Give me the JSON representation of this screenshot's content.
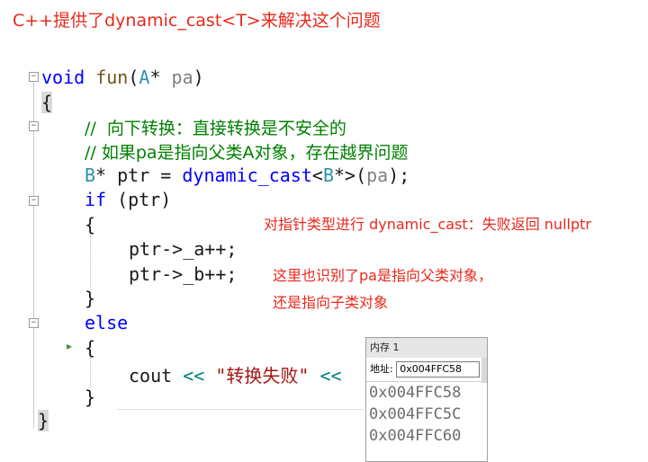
{
  "title": "C++提供了dynamic_cast<T>来解决这个问题",
  "code": {
    "line1": {
      "kw": "void",
      "fn": "fun",
      "open": "(",
      "type": "A",
      "star": "* ",
      "param": "pa",
      "close": ")"
    },
    "line2": "{",
    "line3": "//  向下转换：直接转换是不安全的",
    "line4": "// 如果pa是指向父类A对象，存在越界问题",
    "line5": {
      "type": "B",
      "star": "* ",
      "var": "ptr",
      "eq": " = ",
      "kw": "dynamic_cast",
      "lt": "<",
      "type2": "B",
      "star2": "*",
      "gt": ">",
      "open": "(",
      "param": "pa",
      "close": ");"
    },
    "line6": {
      "kw": "if",
      "rest": " (ptr)"
    },
    "line7": "{",
    "line8": "ptr->_a++;",
    "line9": "ptr->_b++;",
    "line10": "}",
    "line11": "else",
    "line12": "{",
    "line13": {
      "id": "cout",
      "op": " << ",
      "str": "\"转换失败\"",
      "op2": " <<"
    },
    "line14": "}",
    "line15": "}"
  },
  "annotations": {
    "a1": "对指针类型进行 dynamic_cast：失败返回 nullptr",
    "a2": "这里也识别了pa是指向父类对象，",
    "a3": "还是指向子类对象"
  },
  "memory": {
    "title": "内存 1",
    "addr_label": "地址:",
    "addr_value": "0x004FFC58",
    "rows": [
      "0x004FFC58",
      "0x004FFC5C",
      "0x004FFC60"
    ]
  }
}
